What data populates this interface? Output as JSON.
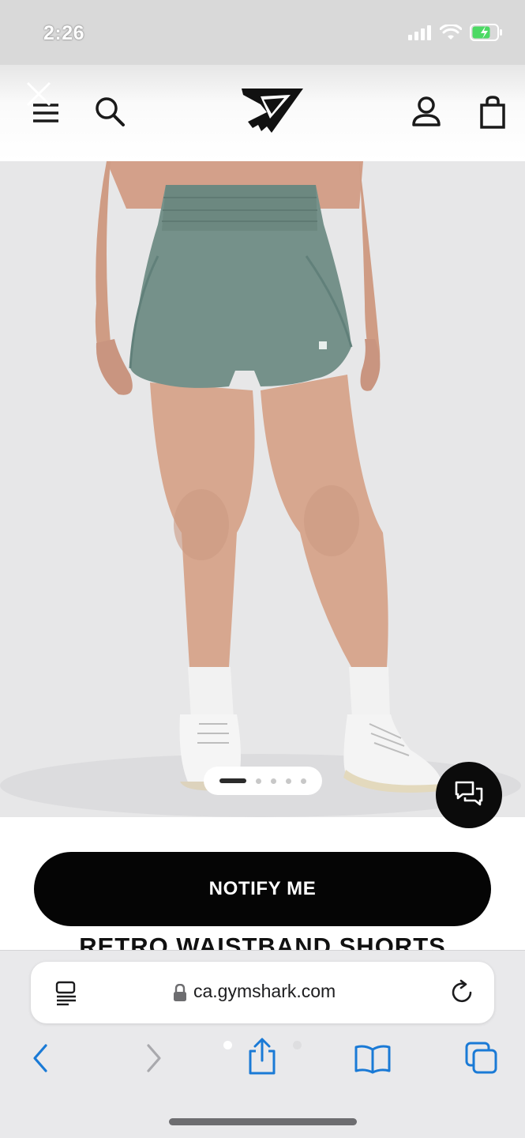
{
  "status_bar": {
    "time": "2:26"
  },
  "header": {
    "menu_icon": "menu-close-icon",
    "search_icon": "search-icon",
    "logo_icon": "gymshark-logo",
    "account_icon": "account-icon",
    "bag_icon": "shopping-bag-icon"
  },
  "product": {
    "image_description_icon": "product-photo",
    "carousel": {
      "total_slides": 5,
      "active_index": 0
    },
    "notify_label": "NOTIFY ME",
    "title": "RETRO WAISTBAND SHORTS"
  },
  "chat": {
    "icon": "chat-bubbles-icon"
  },
  "browser": {
    "url": "ca.gymshark.com",
    "reader_icon": "reader-icon",
    "lock_icon": "lock-icon",
    "reload_icon": "reload-icon",
    "toolbar": {
      "back_icon": "back-icon",
      "forward_icon": "forward-icon",
      "share_icon": "share-icon",
      "bookmarks_icon": "bookmarks-icon",
      "tabs_icon": "tabs-icon"
    }
  },
  "colors": {
    "accent": "#1a7ad6",
    "button_bg": "#050505",
    "shorts": "#75918a"
  }
}
